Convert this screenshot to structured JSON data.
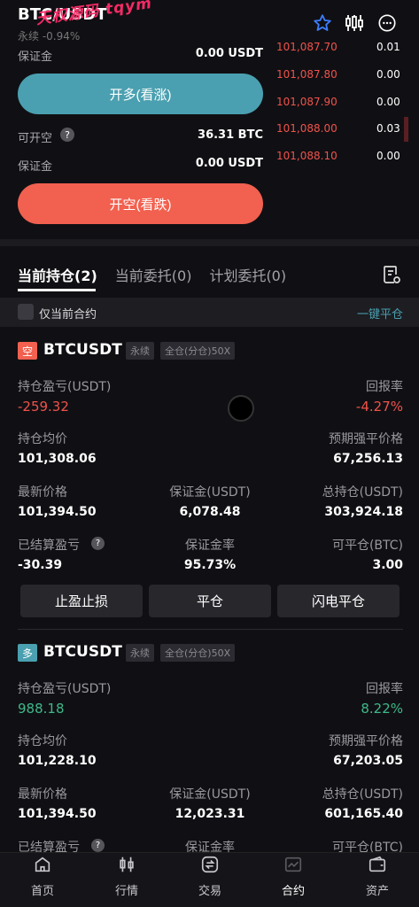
{
  "watermark": "天权源码 tqym",
  "header": {
    "symbol": "BTC/USDT",
    "subtitle": "永续  -0.94%"
  },
  "trade": {
    "margin_label_1": "保证金",
    "margin_value_1": "0.00 USDT",
    "long_button": "开多(看涨)",
    "can_short_label": "可开空",
    "can_short_value": "36.31 BTC",
    "margin_label_2": "保证金",
    "margin_value_2": "0.00 USDT",
    "short_button": "开空(看跌)"
  },
  "orderbook": {
    "asks": [
      {
        "price": "101,087.70",
        "qty": "0.01",
        "depth": 0.1
      },
      {
        "price": "101,087.80",
        "qty": "0.00",
        "depth": 0
      },
      {
        "price": "101,087.90",
        "qty": "0.00",
        "depth": 0
      },
      {
        "price": "101,088.00",
        "qty": "0.03",
        "depth": 0.6
      },
      {
        "price": "101,088.10",
        "qty": "0.00",
        "depth": 0
      }
    ]
  },
  "tabs": {
    "current_positions": "当前持仓(2)",
    "current_orders": "当前委托(0)",
    "plan_orders": "计划委托(0)"
  },
  "filter": {
    "only_current": "仅当前合约",
    "close_all": "一键平仓"
  },
  "positions": [
    {
      "side": "空",
      "symbol": "BTCUSDT",
      "tag1": "永续",
      "tag2": "全仓(分仓)50X",
      "pnl_label": "持仓盈亏(USDT)",
      "pnl": "-259.32",
      "roe_label": "回报率",
      "roe": "-4.27%",
      "avg_label": "持仓均价",
      "avg": "101,308.06",
      "liq_label": "预期强平价格",
      "liq": "67,256.13",
      "last_label": "最新价格",
      "last": "101,394.50",
      "margin_label": "保证金(USDT)",
      "margin": "6,078.48",
      "total_label": "总持仓(USDT)",
      "total": "303,924.18",
      "realized_label": "已结算盈亏",
      "realized": "-30.39",
      "rate_label": "保证金率",
      "rate": "95.73%",
      "closable_label": "可平仓(BTC)",
      "closable": "3.00",
      "btn_tpsl": "止盈止损",
      "btn_close": "平仓",
      "btn_flash": "闪电平仓"
    },
    {
      "side": "多",
      "symbol": "BTCUSDT",
      "tag1": "永续",
      "tag2": "全仓(分仓)50X",
      "pnl_label": "持仓盈亏(USDT)",
      "pnl": "988.18",
      "roe_label": "回报率",
      "roe": "8.22%",
      "avg_label": "持仓均价",
      "avg": "101,228.10",
      "liq_label": "预期强平价格",
      "liq": "67,203.05",
      "last_label": "最新价格",
      "last": "101,394.50",
      "margin_label": "保证金(USDT)",
      "margin": "12,023.31",
      "total_label": "总持仓(USDT)",
      "total": "601,165.40",
      "realized_label": "已结算盈亏",
      "rate_label": "保证金率",
      "closable_label": "可平仓(BTC)"
    }
  ],
  "nav": [
    {
      "label": "首页",
      "icon": "home-icon"
    },
    {
      "label": "行情",
      "icon": "candlestick-icon"
    },
    {
      "label": "交易",
      "icon": "exchange-icon"
    },
    {
      "label": "合约",
      "icon": "contract-chart-icon"
    },
    {
      "label": "资产",
      "icon": "wallet-icon"
    }
  ],
  "colors": {
    "long": "#4aa0b0",
    "short": "#f2604f",
    "up": "#3fb889",
    "down": "#f0524b"
  }
}
